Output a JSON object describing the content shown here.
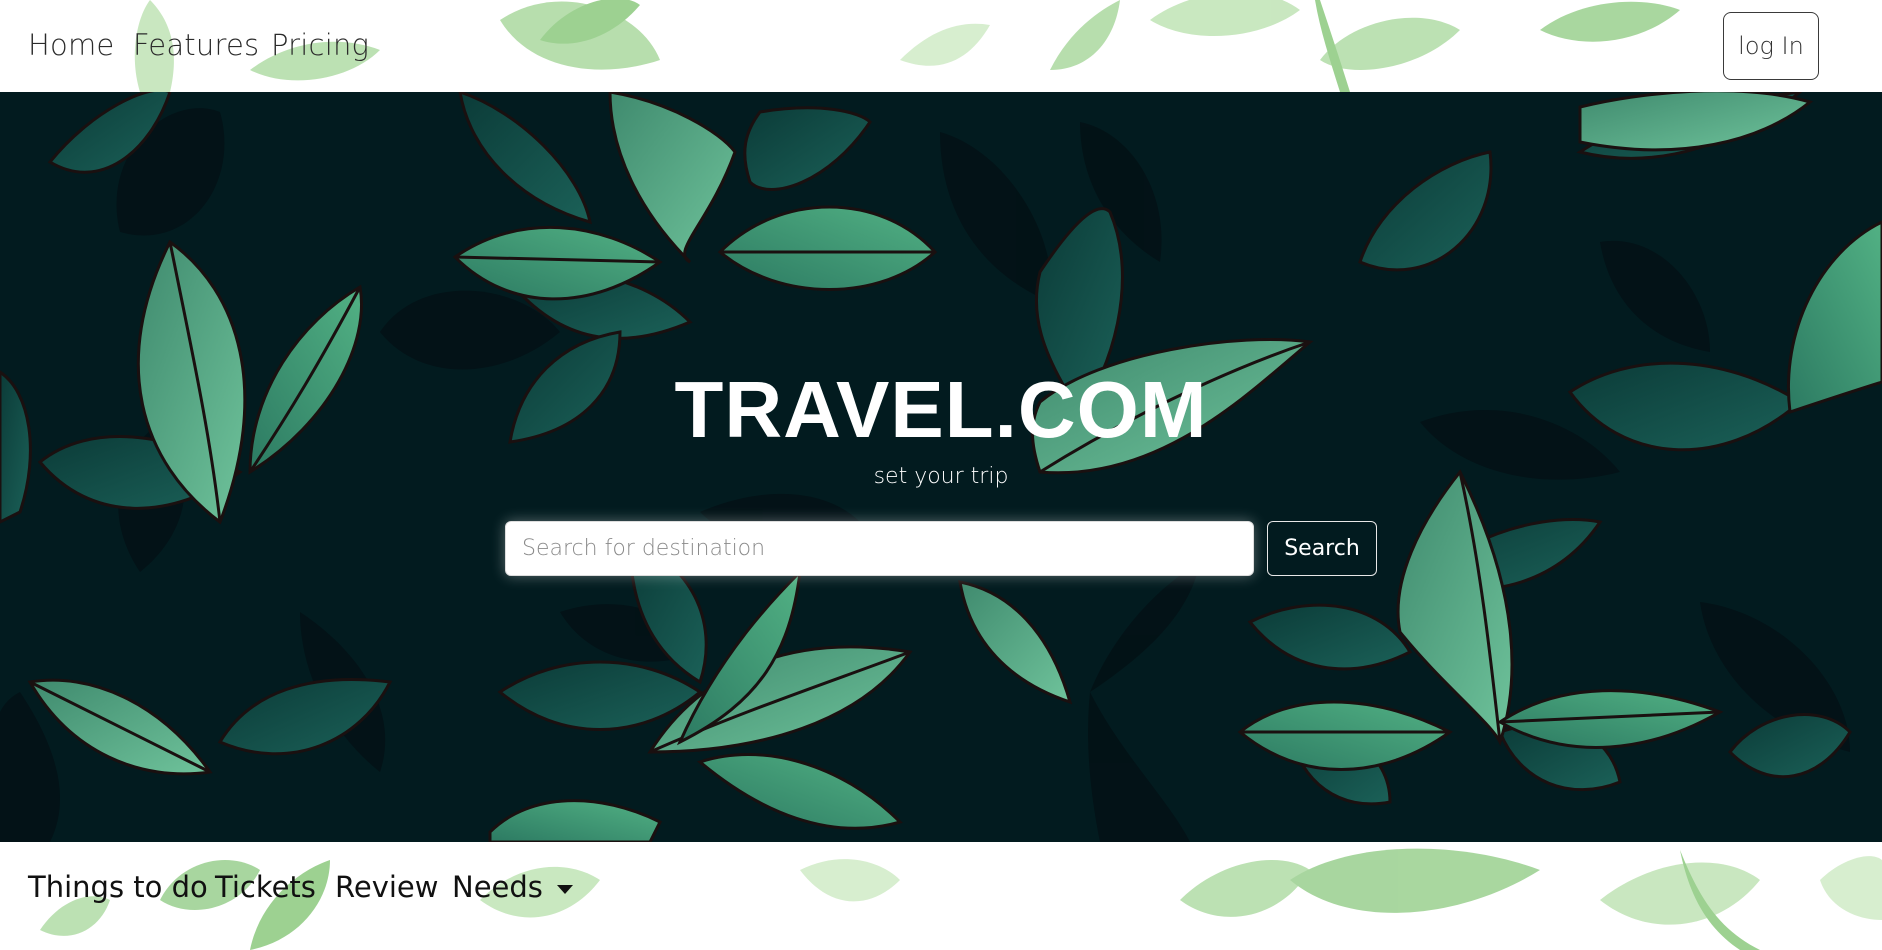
{
  "nav": {
    "links": [
      "Home",
      "Features",
      "Pricing"
    ],
    "login_label": "log In"
  },
  "hero": {
    "title": "TRAVEL.COM",
    "subtitle": "set your trip",
    "search_placeholder": "Search for destination",
    "search_value": "",
    "search_button": "Search"
  },
  "subnav": {
    "links": [
      "Things to do",
      "Tickets",
      "Review"
    ],
    "dropdown_label": "Needs"
  },
  "colors": {
    "hero_bg": "#021b1f",
    "leaf_light": "#6cc090",
    "leaf_dark": "#17564d",
    "page_leaf": "#8fcf80"
  }
}
